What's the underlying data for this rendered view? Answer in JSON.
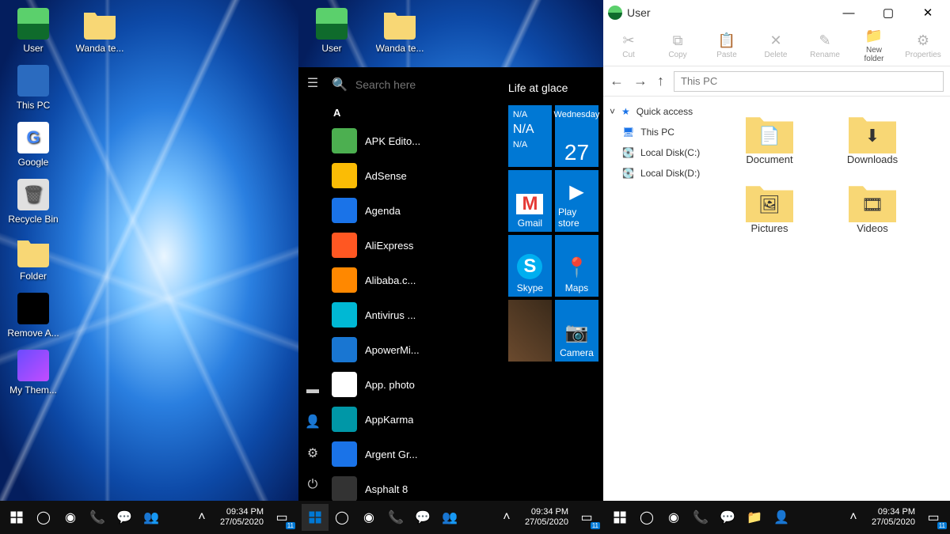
{
  "datetime": {
    "time": "09:34 PM",
    "date": "27/05/2020"
  },
  "action_center_badge": "11",
  "panel1": {
    "desktop_col1": [
      {
        "label": "User",
        "icon": "user"
      },
      {
        "label": "This PC",
        "icon": "pc"
      },
      {
        "label": "Google",
        "icon": "google"
      },
      {
        "label": "Recycle Bin",
        "icon": "bin"
      },
      {
        "label": "Folder",
        "icon": "folder"
      },
      {
        "label": "Remove A...",
        "icon": "black"
      },
      {
        "label": "My Them...",
        "icon": "theme"
      }
    ],
    "desktop_col2": [
      {
        "label": "Wanda te...",
        "icon": "folder"
      }
    ]
  },
  "panel2": {
    "desktop": [
      {
        "label": "User",
        "icon": "user"
      },
      {
        "label": "Wanda te...",
        "icon": "folder"
      }
    ],
    "search_placeholder": "Search here",
    "right_title": "Life at glace",
    "letter_header": "A",
    "apps": [
      {
        "label": "APK Edito...",
        "cls": "bg-gr"
      },
      {
        "label": "AdSense",
        "cls": "bg-ye circ"
      },
      {
        "label": "Agenda",
        "cls": "bg-bl circ"
      },
      {
        "label": "AliExpress",
        "cls": "bg-or"
      },
      {
        "label": "Alibaba.c...",
        "cls": "bg-or2 circ"
      },
      {
        "label": "Antivirus ...",
        "cls": "bg-cy"
      },
      {
        "label": "ApowerMi...",
        "cls": "bg-bl2"
      },
      {
        "label": "App. photo",
        "cls": "bg-wh circ"
      },
      {
        "label": "AppKarma",
        "cls": "bg-te circ"
      },
      {
        "label": "Argent Gr...",
        "cls": "bg-bl"
      },
      {
        "label": "Asphalt 8",
        "cls": "bg-dk circ"
      }
    ],
    "tiles": {
      "weather": {
        "l1": "N/A",
        "l2": "N/A",
        "l3": "N/A"
      },
      "calendar": {
        "weekday": "Wednesday",
        "day": "27"
      },
      "gmail": "Gmail",
      "playstore": "Play store",
      "skype": "Skype",
      "maps": "Maps",
      "gallery": "",
      "camera": "Camera"
    }
  },
  "panel3": {
    "title": "User",
    "ribbon": [
      {
        "label": "Cut",
        "active": false
      },
      {
        "label": "Copy",
        "active": false
      },
      {
        "label": "Paste",
        "active": false
      },
      {
        "label": "Delete",
        "active": false
      },
      {
        "label": "Rename",
        "active": false
      },
      {
        "label": "New folder",
        "active": true
      },
      {
        "label": "Properties",
        "active": false
      }
    ],
    "address_placeholder": "This PC",
    "sidebar": {
      "quick": "Quick access",
      "thispc": "This PC",
      "c": "Local Disk(C:)",
      "d": "Local Disk(D:)"
    },
    "items": [
      {
        "label": "Document",
        "ov": "📄"
      },
      {
        "label": "Downloads",
        "ov": "⬇"
      },
      {
        "label": "Pictures",
        "ov": "🖼"
      },
      {
        "label": "Videos",
        "ov": "🎞"
      }
    ]
  }
}
